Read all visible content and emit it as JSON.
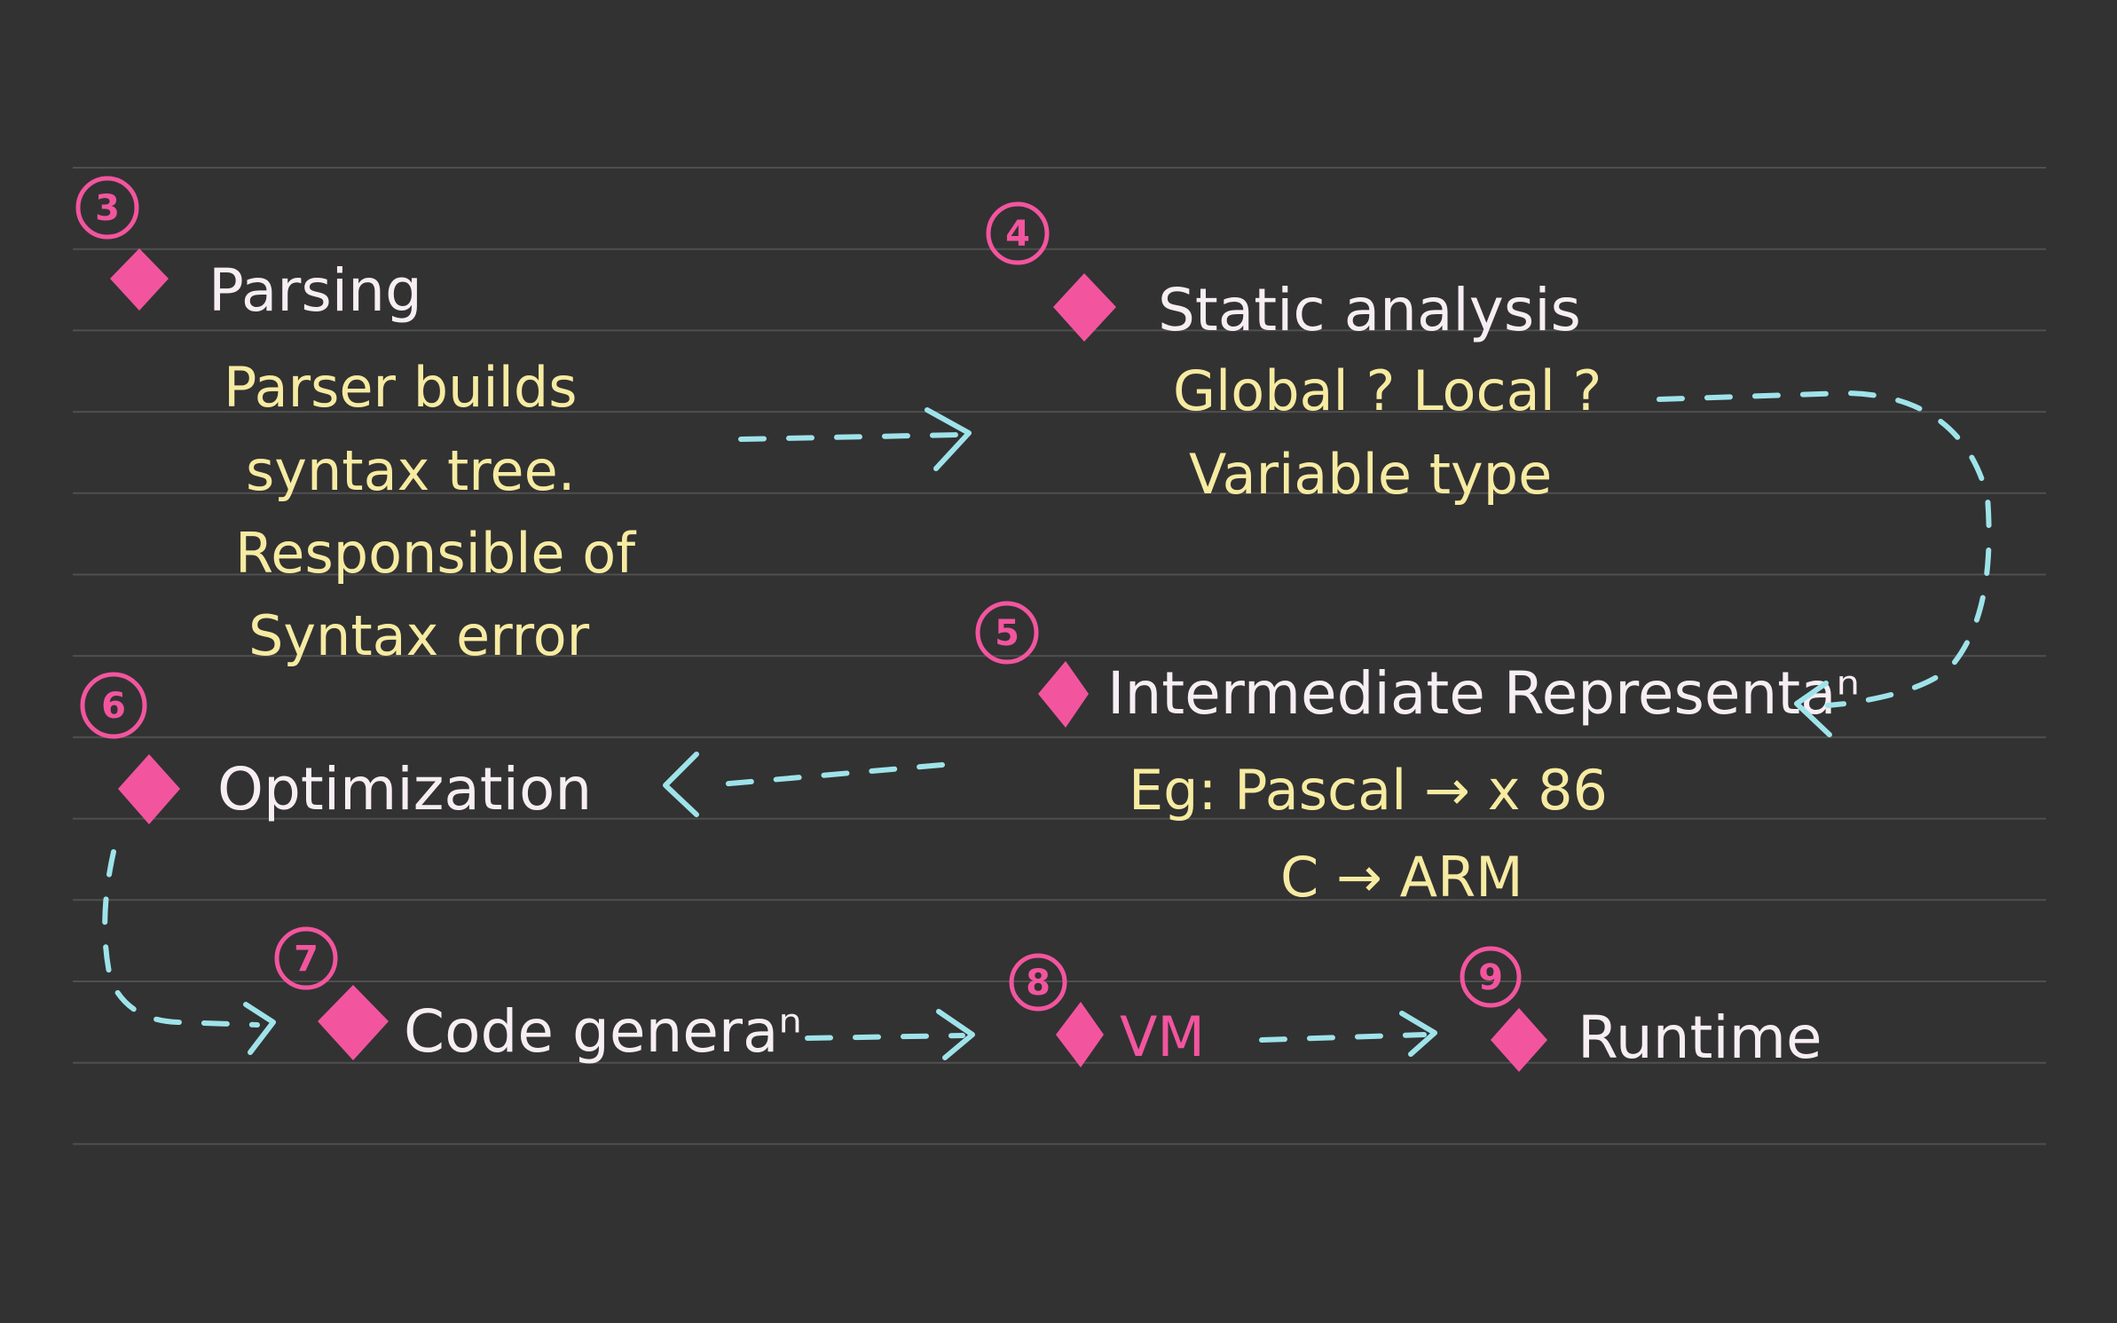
{
  "steps": [
    {
      "badge": "3",
      "title": "Parsing",
      "notes": [
        "Parser builds",
        "syntax tree.",
        "Responsible of",
        "Syntax error"
      ]
    },
    {
      "badge": "4",
      "title": "Static analysis",
      "notes": [
        "Global ? Local ?",
        "Variable type"
      ]
    },
    {
      "badge": "5",
      "title": "Intermediate Representaⁿ",
      "notes": [
        "Eg: Pascal → x 86",
        "C → ARM"
      ]
    },
    {
      "badge": "6",
      "title": "Optimization",
      "notes": []
    },
    {
      "badge": "7",
      "title": "Code generaⁿ",
      "notes": []
    },
    {
      "badge": "8",
      "title": "VM",
      "notes": []
    },
    {
      "badge": "9",
      "title": "Runtime",
      "notes": []
    }
  ],
  "colors": {
    "background": "#323232",
    "ruling": "#4f4f4f",
    "accent_pink": "#f2559e",
    "arrow_cyan": "#9fe3ea",
    "title_white": "#f6eef3",
    "note_yellow": "#f7eba2"
  }
}
